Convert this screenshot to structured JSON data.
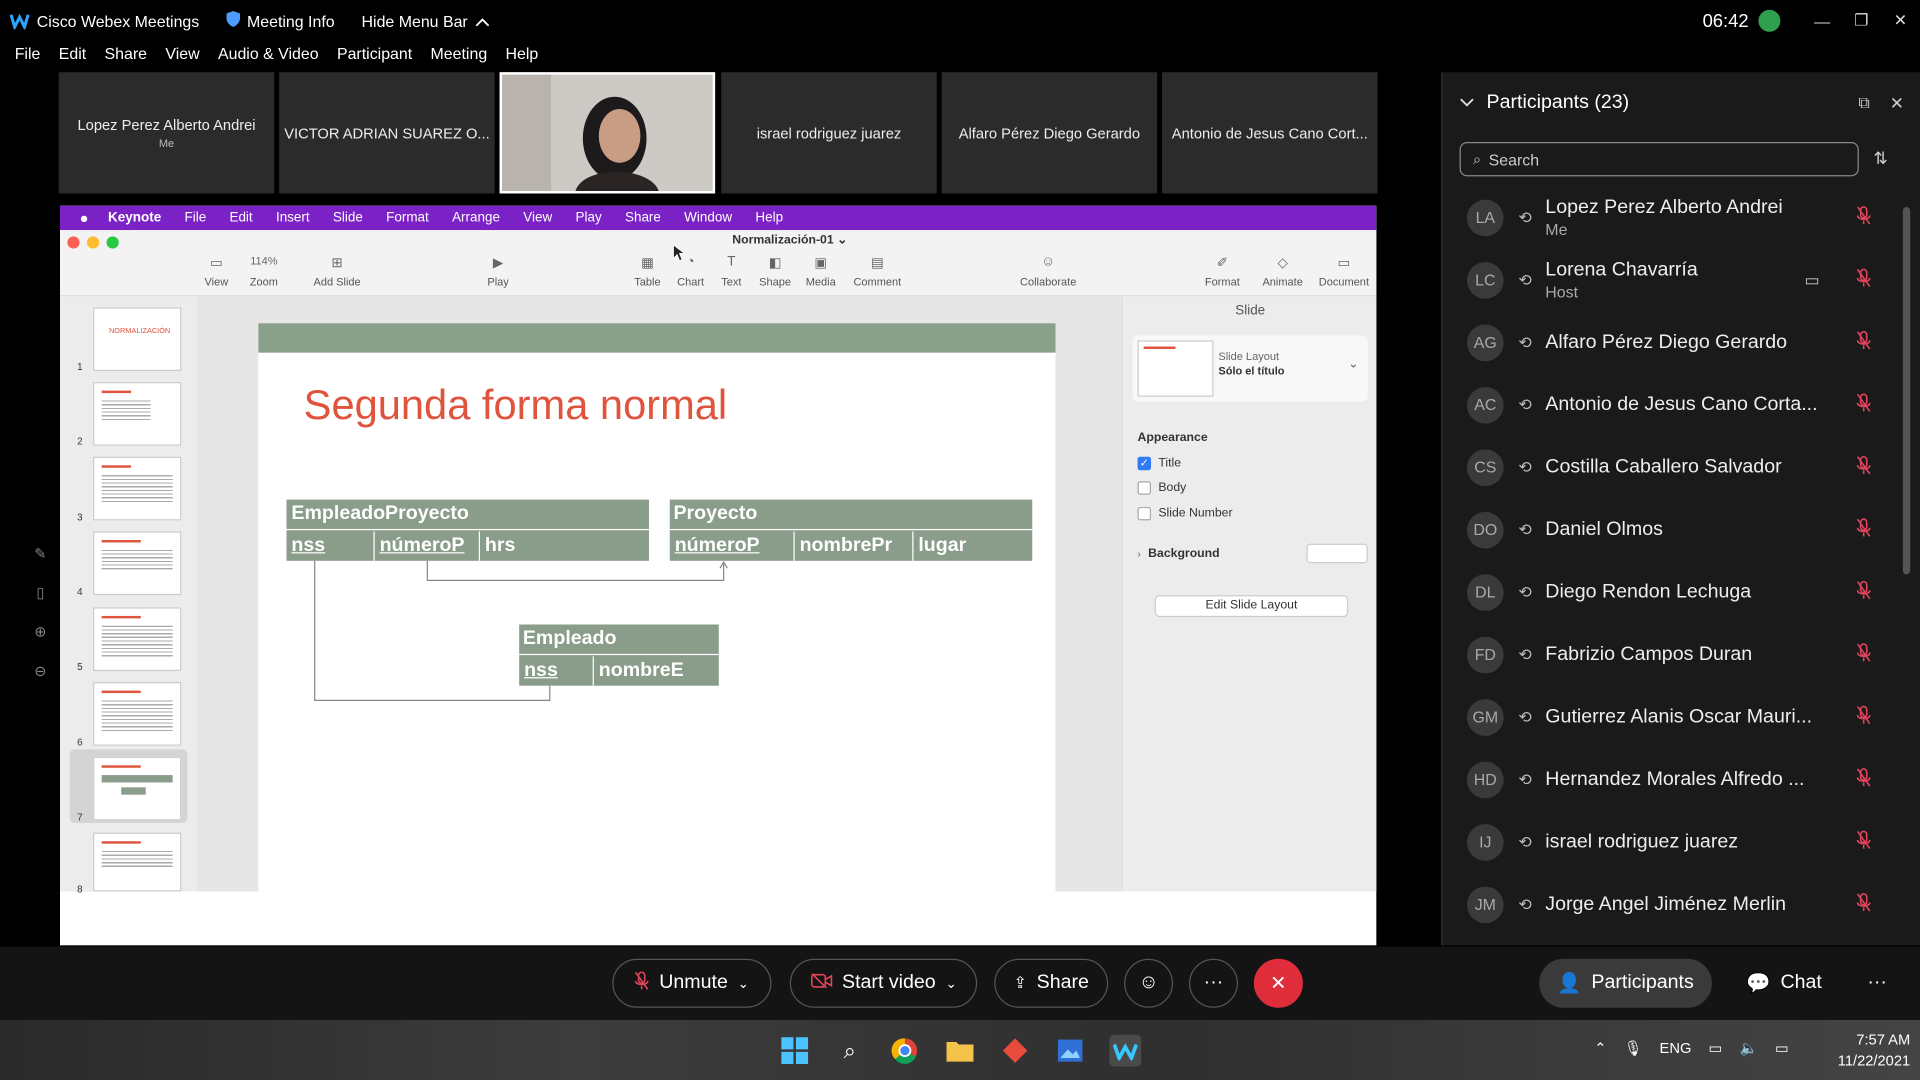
{
  "titlebar": {
    "app_title": "Cisco Webex Meetings",
    "meeting_info": "Meeting Info",
    "hide_menu_bar": "Hide Menu Bar",
    "clock": "06:42"
  },
  "menubar": [
    "File",
    "Edit",
    "Share",
    "View",
    "Audio & Video",
    "Participant",
    "Meeting",
    "Help"
  ],
  "video_tiles": [
    {
      "name": "Lopez Perez Alberto Andrei",
      "sub": "Me"
    },
    {
      "name": "VICTOR ADRIAN SUAREZ O...",
      "sub": ""
    },
    {
      "name": "",
      "sub": ""
    },
    {
      "name": "israel rodriguez juarez",
      "sub": ""
    },
    {
      "name": "Alfaro Pérez Diego Gerardo",
      "sub": ""
    },
    {
      "name": "Antonio de Jesus Cano Cort...",
      "sub": ""
    }
  ],
  "keynote": {
    "mac_menu": [
      "Keynote",
      "File",
      "Edit",
      "Insert",
      "Slide",
      "Format",
      "Arrange",
      "View",
      "Play",
      "Share",
      "Window",
      "Help"
    ],
    "doc_title": "Normalización-01",
    "toolbar": {
      "view": "View",
      "zoom_value": "114%",
      "zoom": "Zoom",
      "add_slide": "Add Slide",
      "play": "Play",
      "table": "Table",
      "chart": "Chart",
      "text": "Text",
      "shape": "Shape",
      "media": "Media",
      "comment": "Comment",
      "collaborate": "Collaborate",
      "format": "Format",
      "animate": "Animate",
      "document": "Document"
    },
    "slide_numbers": [
      "1",
      "2",
      "3",
      "4",
      "5",
      "6",
      "7",
      "8"
    ],
    "slide1_thumb": "NORMALIZACIÓN",
    "slide": {
      "title": "Segunda forma normal",
      "rel1": {
        "name": "EmpleadoProyecto",
        "cols": [
          "nss",
          "númeroP",
          "hrs"
        ]
      },
      "rel2": {
        "name": "Proyecto",
        "cols": [
          "númeroP",
          "nombrePr",
          "lugar"
        ]
      },
      "rel3": {
        "name": "Empleado",
        "cols": [
          "nss",
          "nombreE"
        ]
      }
    },
    "inspector": {
      "header": "Slide",
      "layout_label": "Slide Layout",
      "layout_value": "Sólo el título",
      "appearance": "Appearance",
      "title": "Title",
      "body": "Body",
      "slide_number": "Slide Number",
      "background": "Background",
      "edit_layout": "Edit Slide Layout"
    }
  },
  "participants": {
    "header": "Participants (23)",
    "search_placeholder": "Search",
    "list": [
      {
        "initials": "LA",
        "name": "Lopez Perez Alberto Andrei",
        "sub": "Me"
      },
      {
        "initials": "LC",
        "name": "Lorena Chavarría",
        "sub": "Host"
      },
      {
        "initials": "AG",
        "name": "Alfaro Pérez Diego Gerardo",
        "sub": ""
      },
      {
        "initials": "AC",
        "name": "Antonio de Jesus Cano Corta...",
        "sub": ""
      },
      {
        "initials": "CS",
        "name": "Costilla Caballero Salvador",
        "sub": ""
      },
      {
        "initials": "DO",
        "name": "Daniel Olmos",
        "sub": ""
      },
      {
        "initials": "DL",
        "name": "Diego Rendon Lechuga",
        "sub": ""
      },
      {
        "initials": "FD",
        "name": "Fabrizio Campos Duran",
        "sub": ""
      },
      {
        "initials": "GM",
        "name": "Gutierrez Alanis Oscar Mauri...",
        "sub": ""
      },
      {
        "initials": "HD",
        "name": "Hernandez Morales Alfredo ...",
        "sub": ""
      },
      {
        "initials": "IJ",
        "name": "israel rodriguez juarez",
        "sub": ""
      },
      {
        "initials": "JM",
        "name": "Jorge Angel Jiménez Merlin",
        "sub": ""
      }
    ]
  },
  "controls": {
    "unmute": "Unmute",
    "start_video": "Start video",
    "share": "Share",
    "participants": "Participants",
    "chat": "Chat"
  },
  "taskbar": {
    "lang": "ENG",
    "time": "7:57 AM",
    "date": "11/22/2021"
  },
  "colors": {
    "keynote_menu": "#7b22c6",
    "slide_title": "#e0533c",
    "relation_bg": "#8a9c8a",
    "end_call": "#e02d3c",
    "mute_red": "#e2445c"
  }
}
